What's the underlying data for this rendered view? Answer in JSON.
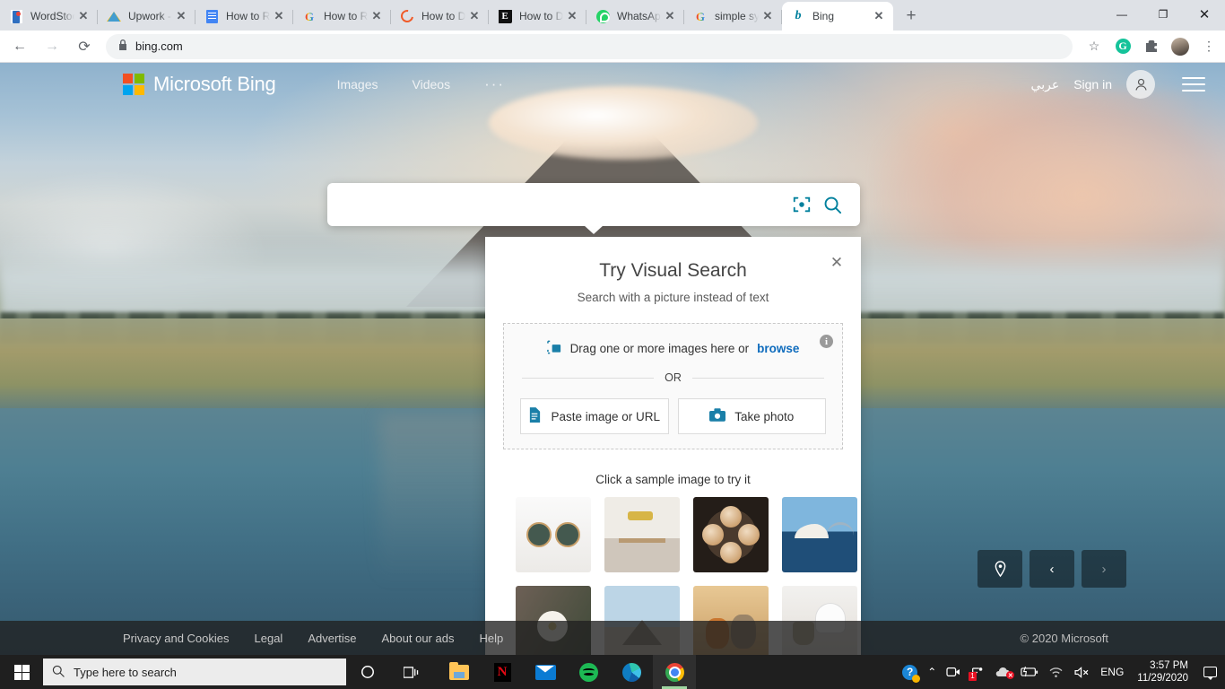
{
  "browser": {
    "tabs": [
      {
        "title": "WordStock",
        "icon": "wordstock-icon"
      },
      {
        "title": "Upwork - G",
        "icon": "google-drive-icon"
      },
      {
        "title": "How to Rev",
        "icon": "google-docs-icon"
      },
      {
        "title": "How to Rev",
        "icon": "google-icon"
      },
      {
        "title": "How to Do",
        "icon": "ring-icon"
      },
      {
        "title": "How to Do",
        "icon": "ed-icon"
      },
      {
        "title": "WhatsApp",
        "icon": "whatsapp-icon"
      },
      {
        "title": "simple sync",
        "icon": "google-icon"
      },
      {
        "title": "Bing",
        "icon": "bing-icon"
      }
    ],
    "active_tab_index": 8,
    "new_tab_label": "+",
    "close_label": "✕",
    "window_controls": {
      "minimize": "—",
      "restore": "❐",
      "close": "✕"
    },
    "nav": {
      "back": "←",
      "forward": "→",
      "reload": "⟳"
    },
    "address": {
      "value": "bing.com",
      "lock": "🔒"
    },
    "toolbar_icons": [
      "bookmark-star-icon",
      "grammarly-icon",
      "extensions-icon",
      "profile-avatar",
      "chrome-menu-icon"
    ],
    "grammarly_letter": "G",
    "menu_glyph": "⋮",
    "star_glyph": "☆",
    "puzzle_glyph": "🧩"
  },
  "bing": {
    "brand": "Microsoft Bing",
    "nav": {
      "images": "Images",
      "videos": "Videos",
      "more": "···"
    },
    "language": "عربي",
    "signin": "Sign in",
    "search": {
      "value": "",
      "placeholder": ""
    },
    "footer": {
      "links": [
        "Privacy and Cookies",
        "Legal",
        "Advertise",
        "About our ads",
        "Help"
      ],
      "copyright": "© 2020 Microsoft"
    },
    "image_controls": {
      "location": "location-pin-icon",
      "prev": "‹",
      "next": "›"
    }
  },
  "visual_search": {
    "title": "Try Visual Search",
    "subtitle": "Search with a picture instead of text",
    "close": "✕",
    "drag_text": "Drag one or more images here or",
    "browse_link": "browse",
    "info_glyph": "i",
    "or_label": "OR",
    "buttons": [
      {
        "label": "Paste image or URL",
        "icon": "paste-document-icon"
      },
      {
        "label": "Take photo",
        "icon": "camera-icon"
      }
    ],
    "sample_title": "Click a sample image to try it",
    "samples": [
      {
        "name": "sunglasses",
        "class": "th-sunglasses"
      },
      {
        "name": "dining-room",
        "class": "th-dining"
      },
      {
        "name": "latte-coffee",
        "class": "th-coffee"
      },
      {
        "name": "sydney-opera-house",
        "class": "th-opera"
      },
      {
        "name": "white-rose",
        "class": "th-rose"
      },
      {
        "name": "louvre-pyramid",
        "class": "th-louvre"
      },
      {
        "name": "two-dogs",
        "class": "th-dogs"
      },
      {
        "name": "white-chair",
        "class": "th-chair"
      }
    ]
  },
  "taskbar": {
    "search_placeholder": "Type here to search",
    "apps": [
      "file-explorer",
      "netflix",
      "mail",
      "spotify",
      "microsoft-edge",
      "google-chrome"
    ],
    "active_app": "google-chrome",
    "tray": {
      "language": "ENG",
      "time": "3:57 PM",
      "date": "11/29/2020",
      "notification_count": "1",
      "chevron": "⌃"
    }
  },
  "colors": {
    "bing_accent": "#00809d",
    "link_blue": "#0f6cbd",
    "chrome_tabstrip": "#dee1e6",
    "taskbar": "#1f1f1f"
  }
}
